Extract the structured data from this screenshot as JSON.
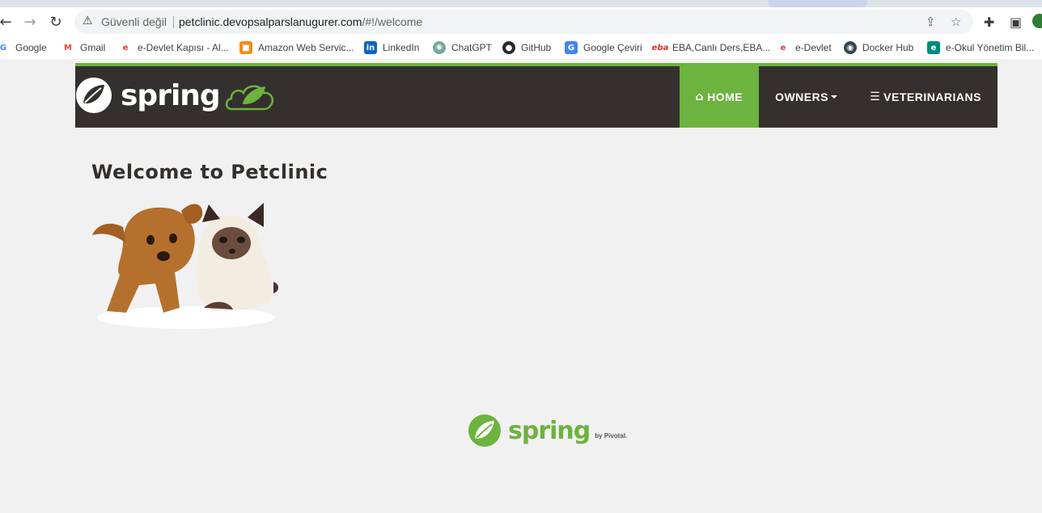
{
  "browser": {
    "insecure_label": "Güvenli değil",
    "url_host": "petclinic.devopsalparslanugurer.com",
    "url_path": "/#!/welcome"
  },
  "bookmarks": [
    {
      "label": "Google",
      "icon": "google-icon",
      "color": "#4285f4"
    },
    {
      "label": "Gmail",
      "icon": "gmail-icon",
      "color": "#ea4335"
    },
    {
      "label": "e-Devlet Kapısı - Al...",
      "icon": "edevlet-icon",
      "color": "#e53935"
    },
    {
      "label": "Amazon Web Servic...",
      "icon": "aws-icon",
      "color": "#f08c1f"
    },
    {
      "label": "LinkedIn",
      "icon": "linkedin-icon",
      "color": "#0a66c2"
    },
    {
      "label": "ChatGPT",
      "icon": "chatgpt-icon",
      "color": "#74aa9c"
    },
    {
      "label": "GitHub",
      "icon": "github-icon",
      "color": "#24292e"
    },
    {
      "label": "Google Çeviri",
      "icon": "translate-icon",
      "color": "#4285f4"
    },
    {
      "label": "EBA,Canlı Ders,EBA...",
      "icon": "eba-icon",
      "color": "#d32f2f"
    },
    {
      "label": "e-Devlet",
      "icon": "edevlet-icon",
      "color": "#e53935"
    },
    {
      "label": "Docker Hub",
      "icon": "dockerhub-icon",
      "color": "#37474f"
    },
    {
      "label": "e-Okul Yönetim Bil...",
      "icon": "eokul-icon",
      "color": "#00897b"
    }
  ],
  "navbar": {
    "logo_text": "spring",
    "items": [
      {
        "label": "HOME",
        "icon": "home-icon",
        "active": true
      },
      {
        "label": "OWNERS",
        "icon": "",
        "dropdown": true
      },
      {
        "label": "VETERINARIANS",
        "icon": "list-icon"
      }
    ]
  },
  "main": {
    "title": "Welcome to Petclinic"
  },
  "footer": {
    "logo_text": "spring",
    "by_text": "by Pivotal."
  },
  "colors": {
    "brand_green": "#6db33f",
    "navbar_bg": "#34302d",
    "page_bg": "#f1f1f1"
  }
}
